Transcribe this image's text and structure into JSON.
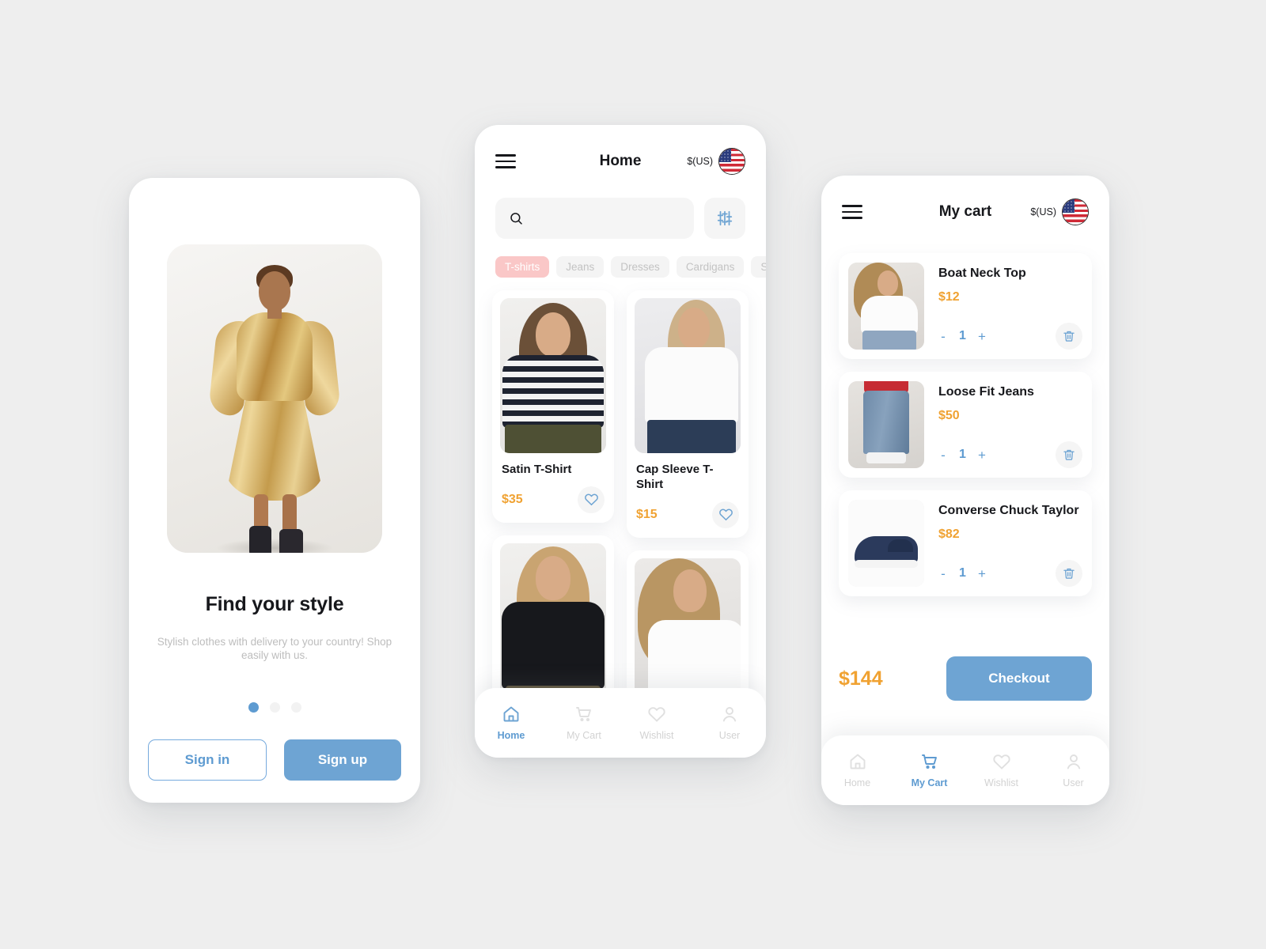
{
  "screens": {
    "onboarding": {
      "title": "Find your style",
      "subtitle": "Stylish clothes with delivery to your country! Shop easily with us.",
      "hero_alt": "gold-satin-dress-model",
      "dots": {
        "count": 3,
        "active_index": 0
      },
      "signin_label": "Sign in",
      "signup_label": "Sign up"
    },
    "home": {
      "appbar": {
        "menu_icon": "hamburger-icon",
        "title": "Home",
        "currency_label": "$(US)",
        "flag_icon": "us-flag-icon"
      },
      "search": {
        "value": "",
        "placeholder": "",
        "icon": "search-icon"
      },
      "filter_icon": "sliders-icon",
      "categories": [
        {
          "label": "T-shirts",
          "active": true
        },
        {
          "label": "Jeans",
          "active": false
        },
        {
          "label": "Dresses",
          "active": false
        },
        {
          "label": "Cardigans",
          "active": false
        },
        {
          "label": "Shoes",
          "active": false
        }
      ],
      "products": [
        {
          "name": "Satin T-Shirt",
          "price": "$35",
          "image": "striped-tee-model",
          "fav_icon": "heart-icon"
        },
        {
          "name": "Cap Sleeve T-Shirt",
          "price": "$15",
          "image": "white-tee-model",
          "fav_icon": "heart-icon"
        },
        {
          "name": "",
          "price": "",
          "image": "black-tee-model",
          "fav_icon": "heart-icon"
        },
        {
          "name": "",
          "price": "",
          "image": "white-top-model",
          "fav_icon": "heart-icon"
        }
      ],
      "nav": [
        {
          "label": "Home",
          "icon": "home-icon",
          "active": true
        },
        {
          "label": "My Cart",
          "icon": "cart-icon",
          "active": false
        },
        {
          "label": "Wishlist",
          "icon": "heart-icon",
          "active": false
        },
        {
          "label": "User",
          "icon": "user-icon",
          "active": false
        }
      ]
    },
    "cart": {
      "appbar": {
        "menu_icon": "hamburger-icon",
        "title": "My cart",
        "currency_label": "$(US)",
        "flag_icon": "us-flag-icon"
      },
      "items": [
        {
          "name": "Boat Neck Top",
          "price": "$12",
          "qty": "1",
          "minus": "-",
          "plus": "+",
          "image": "white-boat-neck-top",
          "delete_icon": "trash-icon"
        },
        {
          "name": "Loose Fit Jeans",
          "price": "$50",
          "qty": "1",
          "minus": "-",
          "plus": "+",
          "image": "blue-jeans",
          "delete_icon": "trash-icon"
        },
        {
          "name": "Converse Chuck Taylor",
          "price": "$82",
          "qty": "1",
          "minus": "-",
          "plus": "+",
          "image": "navy-sneaker",
          "delete_icon": "trash-icon"
        }
      ],
      "total": "$144",
      "checkout_label": "Checkout",
      "nav": [
        {
          "label": "Home",
          "icon": "home-icon",
          "active": false
        },
        {
          "label": "My Cart",
          "icon": "cart-icon",
          "active": true
        },
        {
          "label": "Wishlist",
          "icon": "heart-icon",
          "active": false
        },
        {
          "label": "User",
          "icon": "user-icon",
          "active": false
        }
      ]
    }
  },
  "colors": {
    "accent_blue": "#5e9bd1",
    "button_blue": "#6ea4d3",
    "price_orange": "#f0a232",
    "chip_active_pink": "#fac7c7",
    "muted_gray": "#c3c3c3",
    "page_background": "#eeeeee"
  }
}
